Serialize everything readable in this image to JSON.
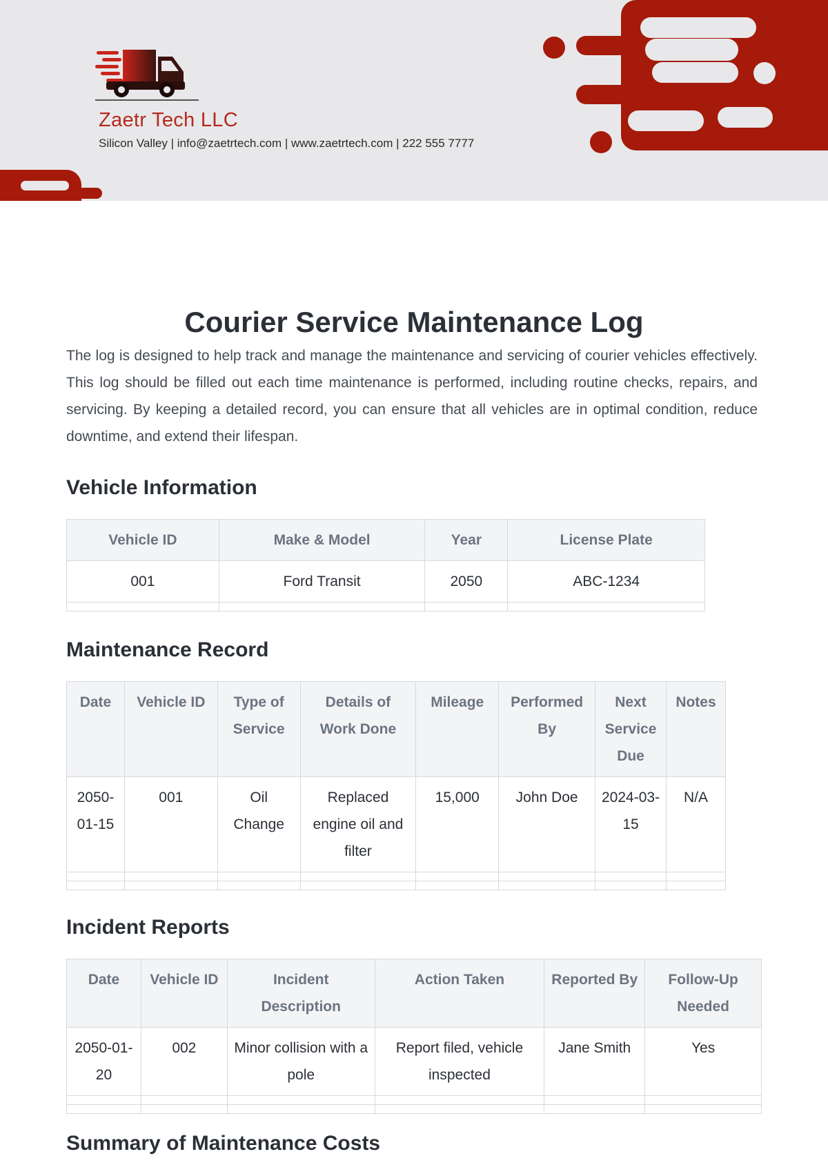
{
  "company": {
    "name": "Zaetr Tech LLC",
    "contact": "Silicon Valley | info@zaetrtech.com | www.zaetrtech.com | 222 555 7777",
    "logo_icon": "delivery-truck-icon",
    "brand_color": "#a51a0a"
  },
  "title": "Courier Service Maintenance Log",
  "intro": "The log is designed to help track and manage the maintenance and servicing of courier vehicles effectively. This log should be filled out each time maintenance is performed, including routine checks, repairs, and servicing. By keeping a detailed record, you can ensure that all vehicles are in optimal condition, reduce downtime, and extend their lifespan.",
  "vehicle_info": {
    "heading": "Vehicle Information",
    "columns": [
      "Vehicle ID",
      "Make & Model",
      "Year",
      "License Plate"
    ],
    "rows": [
      [
        "001",
        "Ford Transit",
        "2050",
        "ABC-1234"
      ]
    ]
  },
  "maintenance": {
    "heading": "Maintenance Record",
    "columns": [
      "Date",
      "Vehicle ID",
      "Type of Service",
      "Details of Work Done",
      "Mileage",
      "Performed By",
      "Next Service Due",
      "Notes"
    ],
    "rows": [
      [
        "2050-01-15",
        "001",
        "Oil Change",
        "Replaced engine oil and filter",
        "15,000",
        "John Doe",
        "2024-03-15",
        "N/A"
      ]
    ]
  },
  "incidents": {
    "heading": "Incident Reports",
    "columns": [
      "Date",
      "Vehicle ID",
      "Incident Description",
      "Action Taken",
      "Reported By",
      "Follow-Up Needed"
    ],
    "rows": [
      [
        "2050-01-20",
        "002",
        "Minor collision with a pole",
        "Report filed, vehicle inspected",
        "Jane Smith",
        "Yes"
      ]
    ]
  },
  "costs": {
    "heading": "Summary of Maintenance Costs"
  }
}
